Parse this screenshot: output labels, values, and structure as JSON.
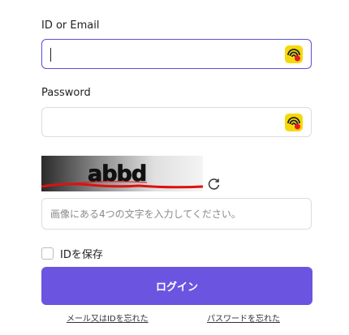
{
  "id_field": {
    "label": "ID or Email",
    "value": ""
  },
  "password_field": {
    "label": "Password",
    "value": ""
  },
  "captcha": {
    "image_text": "abbd",
    "placeholder": "画像にある4つの文字を入力してください。"
  },
  "remember": {
    "label": "IDを保存",
    "checked": false
  },
  "login_button": {
    "label": "ログイン"
  },
  "links": {
    "forgot_id": "メール又はIDを忘れた",
    "forgot_password": "パスワードを忘れた"
  },
  "colors": {
    "accent": "#6b55e0",
    "focus_border": "#5b4fd6",
    "icon_yellow": "#f5d90a",
    "icon_red": "#e8192c",
    "captcha_line": "#dd1111"
  },
  "icons": {
    "password_manager": "password-manager-icon",
    "refresh": "refresh-icon"
  }
}
